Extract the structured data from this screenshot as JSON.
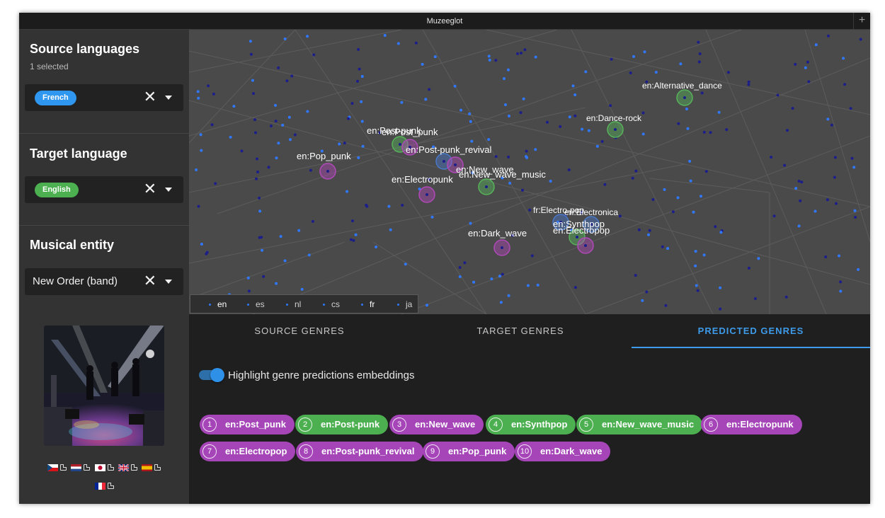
{
  "app": {
    "title": "Muzeeglot",
    "new_tab": "+"
  },
  "colors": {
    "french_chip": "#2f97ef",
    "english_chip": "#4caf50",
    "predicted_purple": "#a545b8",
    "predicted_green": "#4caf50",
    "accent": "#3d9be9"
  },
  "sidebar": {
    "source": {
      "title": "Source languages",
      "subtitle": "1 selected",
      "chip": "French"
    },
    "target": {
      "title": "Target language",
      "chip": "English"
    },
    "entity": {
      "title": "Musical entity",
      "value": "New Order (band)"
    },
    "clear_symbol": "✕",
    "flags": [
      "cz-flag",
      "nl-flag",
      "jp-flag",
      "gb-flag",
      "es-flag",
      "fr-flag"
    ]
  },
  "embedding": {
    "labels": [
      "en:Alternative_dance",
      "en:Dance-rock",
      "en:Post-punk",
      "en:Post_punk",
      "en:Post-punk_revival",
      "en:Pop_punk",
      "en:Electropunk",
      "en:New_wave",
      "en:New_wave_music",
      "fr:Electro-pop",
      "en:Electronica",
      "en:Synthpop",
      "en:Electropop",
      "en:Dark_wave"
    ],
    "languages": [
      "en",
      "es",
      "nl",
      "cs",
      "fr",
      "ja"
    ]
  },
  "tabs": [
    "SOURCE GENRES",
    "TARGET GENRES",
    "PREDICTED GENRES"
  ],
  "predicted": {
    "toggle_label": "Highlight genre predictions embeddings",
    "toggle_on": true,
    "genres": [
      {
        "rank": "1",
        "label": "en:Post_punk",
        "color": "purple"
      },
      {
        "rank": "2",
        "label": "en:Post-punk",
        "color": "green"
      },
      {
        "rank": "3",
        "label": "en:New_wave",
        "color": "purple"
      },
      {
        "rank": "4",
        "label": "en:Synthpop",
        "color": "green"
      },
      {
        "rank": "5",
        "label": "en:New_wave_music",
        "color": "green"
      },
      {
        "rank": "6",
        "label": "en:Electropunk",
        "color": "purple"
      },
      {
        "rank": "7",
        "label": "en:Electropop",
        "color": "purple"
      },
      {
        "rank": "8",
        "label": "en:Post-punk_revival",
        "color": "purple"
      },
      {
        "rank": "9",
        "label": "en:Pop_punk",
        "color": "purple"
      },
      {
        "rank": "10",
        "label": "en:Dark_wave",
        "color": "purple"
      }
    ]
  }
}
